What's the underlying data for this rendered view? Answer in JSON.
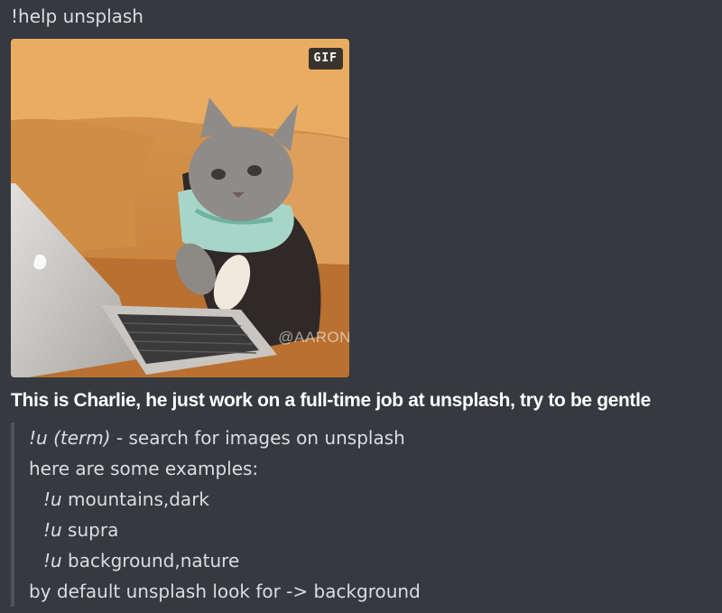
{
  "message": {
    "command_text": "!help unsplash",
    "attachment": {
      "badge": "GIF",
      "watermark": "@AARON"
    },
    "headline": "This is Charlie, he just work on a full-time job at unsplash, try to be gentle",
    "help": {
      "usage": {
        "cmd": "!u",
        "term": "(term)",
        "desc": " - search for images on unsplash"
      },
      "examples_intro": "here are some examples:",
      "examples": [
        {
          "cmd": "!u",
          "arg": " mountains,dark"
        },
        {
          "cmd": "!u",
          "arg": " supra"
        },
        {
          "cmd": "!u",
          "arg": " background,nature"
        }
      ],
      "default_note": "by default unsplash look for -> background"
    }
  },
  "colors": {
    "background": "#36393f",
    "text": "#dcddde",
    "headline": "#ffffff",
    "quote_bar": "#4f545c"
  }
}
